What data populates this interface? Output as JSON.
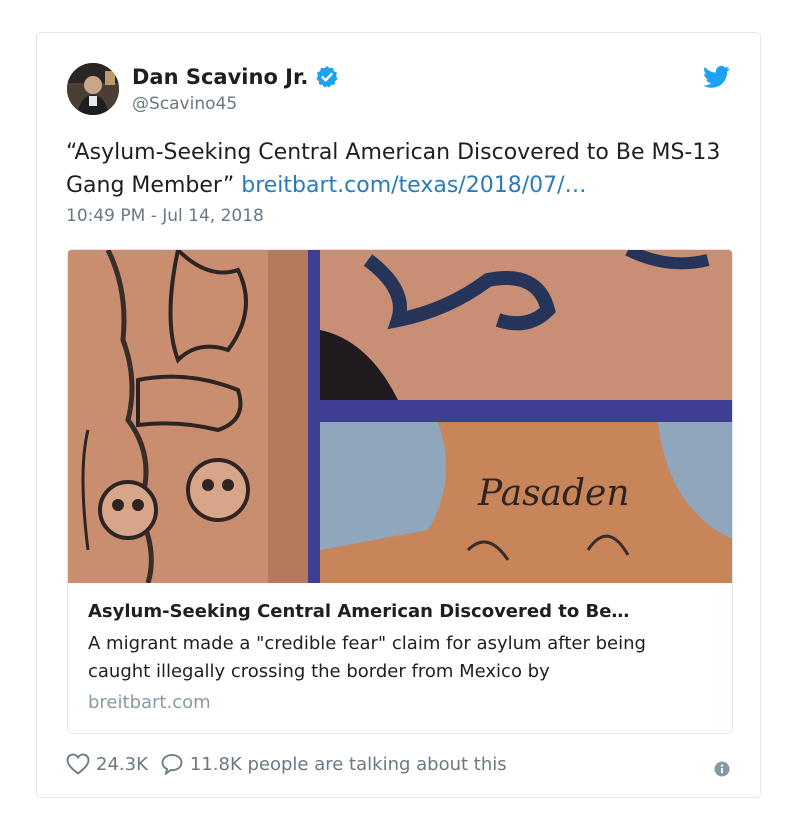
{
  "author": {
    "name": "Dan Scavino Jr.",
    "handle": "@Scavino45",
    "verified": true
  },
  "tweet": {
    "text": "“Asylum-Seeking Central American Discovered to Be MS-13 Gang Member”",
    "link": "breitbart.com/texas/2018/07/…",
    "timestamp": "10:49 PM - Jul 14, 2018"
  },
  "card": {
    "title": "Asylum-Seeking Central American Discovered to Be…",
    "description": "A migrant made a \"credible fear\" claim for asylum after being caught illegally crossing the border from Mexico by",
    "domain": "breitbart.com",
    "neck_tattoo_text": "Pasaden"
  },
  "actions": {
    "likes": "24.3K",
    "replies_label": "11.8K people are talking about this"
  },
  "icons": {
    "like": "heart-icon",
    "reply": "speech-bubble-icon",
    "info": "info-icon",
    "brand": "twitter-bird-icon",
    "verified": "verified-badge-icon"
  },
  "colors": {
    "link": "#2b7bb9",
    "verified": "#1da1f2",
    "muted": "#697882"
  }
}
